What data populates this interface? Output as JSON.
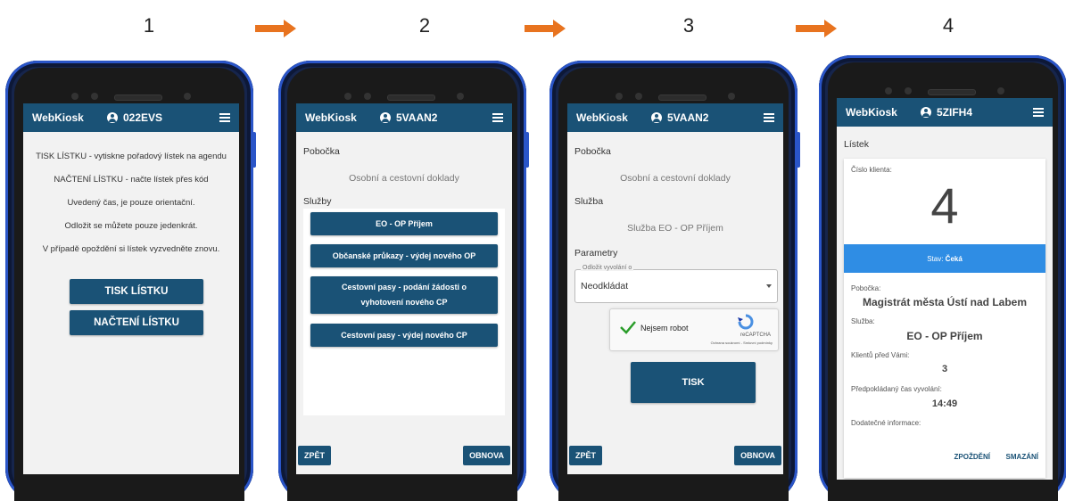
{
  "steps": [
    "1",
    "2",
    "3",
    "4"
  ],
  "colors": {
    "appbar": "#1a5276",
    "arrow": "#e8731f",
    "status": "#2f8de4",
    "phone_frame": "#2a55c8"
  },
  "app": {
    "brand": "WebKiosk"
  },
  "screen1": {
    "user": "022EVS",
    "lines": [
      "TISK LÍSTKU - vytiskne pořadový lístek na agendu",
      "NAČTENÍ LÍSTKU - načte lístek přes kód",
      "Uvedený čas, je pouze orientační.",
      "Odložit se můžete pouze jedenkrát.",
      "V případě opoždění si lístek vyzvedněte znovu."
    ],
    "print_button": "TISK LÍSTKU",
    "load_button": "NAČTENÍ LÍSTKU"
  },
  "screen2": {
    "user": "5VAAN2",
    "branch_label": "Pobočka",
    "branch_value": "Osobní a cestovní doklady",
    "services_label": "Služby",
    "services": [
      "EO - OP Příjem",
      "Občanské průkazy - výdej nového OP",
      "Cestovní pasy - podání žádosti o vyhotovení nového CP",
      "Cestovní pasy - výdej nového CP"
    ],
    "back_button": "ZPĚT",
    "refresh_button": "OBNOVA"
  },
  "screen3": {
    "user": "5VAAN2",
    "branch_label": "Pobočka",
    "branch_value": "Osobní a cestovní doklady",
    "service_label": "Služba",
    "service_value": "Služba EO - OP Příjem",
    "params_label": "Parametry",
    "select_label": "Odložit vyvolání o",
    "select_value": "Neodkládat",
    "captcha_label": "Nejsem robot",
    "captcha_brand": "reCAPTCHA",
    "captcha_terms": "Ochrana soukromí - Smluvní podmínky",
    "print_button": "TISK",
    "back_button": "ZPĚT",
    "refresh_button": "OBNOVA"
  },
  "screen4": {
    "user": "5ZIFH4",
    "title": "Lístek",
    "client_no_label": "Číslo klienta:",
    "client_no": "4",
    "status_label": "Stav:",
    "status_value": "Čeká",
    "branch_label": "Pobočka:",
    "branch_value": "Magistrát města Ústí nad Labem",
    "service_label": "Služba:",
    "service_value": "EO - OP Příjem",
    "before_label": "Klientů před Vámi:",
    "before_value": "3",
    "time_label": "Předpokládaný čas vyvolání:",
    "time_value": "14:49",
    "extra_label": "Dodatečné informace:",
    "delay_button": "ZPOŽDĚNÍ",
    "delete_button": "SMAZÁNÍ"
  }
}
